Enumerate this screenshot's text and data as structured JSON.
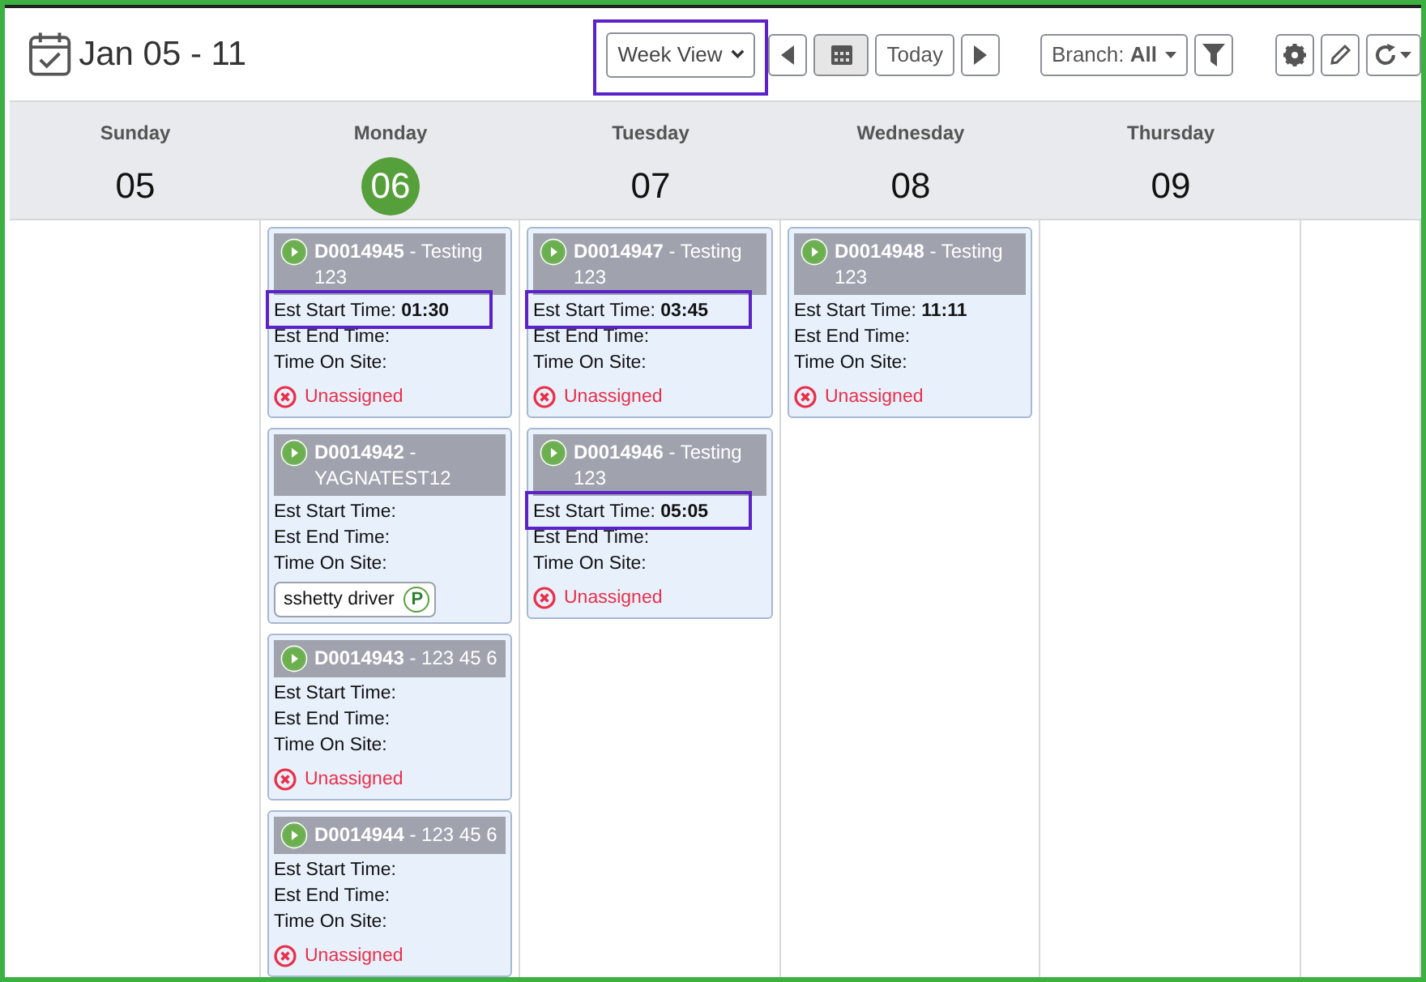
{
  "header": {
    "title": "Jan 05 - 11",
    "view_select": {
      "value": "Week View",
      "highlighted": true
    },
    "today_button": "Today",
    "branch": {
      "label": "Branch:",
      "value": "All"
    }
  },
  "days": [
    {
      "name": "Sunday",
      "number": "05",
      "selected": false
    },
    {
      "name": "Monday",
      "number": "06",
      "selected": true,
      "jobs": [
        {
          "id": "D0014945",
          "title": " - Testing 123",
          "start_label": "Est Start Time:",
          "start_time": "01:30",
          "start_highlighted": true,
          "end_label": "Est End Time:",
          "site_label": "Time On Site:",
          "assignment": {
            "kind": "unassigned",
            "text": "Unassigned"
          }
        },
        {
          "id": "D0014942",
          "title": " - YAGNATEST12",
          "start_label": "Est Start Time:",
          "start_highlighted": false,
          "end_label": "Est End Time:",
          "site_label": "Time On Site:",
          "assignment": {
            "kind": "driver",
            "text": "sshetty driver",
            "badge": "P"
          }
        },
        {
          "id": "D0014943",
          "title": " - 123 45 6",
          "start_label": "Est Start Time:",
          "start_highlighted": false,
          "end_label": "Est End Time:",
          "site_label": "Time On Site:",
          "assignment": {
            "kind": "unassigned",
            "text": "Unassigned"
          }
        },
        {
          "id": "D0014944",
          "title": " - 123 45 6",
          "start_label": "Est Start Time:",
          "start_highlighted": false,
          "end_label": "Est End Time:",
          "site_label": "Time On Site:",
          "assignment": {
            "kind": "unassigned",
            "text": "Unassigned"
          }
        }
      ]
    },
    {
      "name": "Tuesday",
      "number": "07",
      "selected": false,
      "jobs": [
        {
          "id": "D0014947",
          "title": " - Testing 123",
          "start_label": "Est Start Time:",
          "start_time": "03:45",
          "start_highlighted": true,
          "end_label": "Est End Time:",
          "site_label": "Time On Site:",
          "assignment": {
            "kind": "unassigned",
            "text": "Unassigned"
          }
        },
        {
          "id": "D0014946",
          "title": " - Testing 123",
          "start_label": "Est Start Time:",
          "start_time": "05:05",
          "start_highlighted": true,
          "end_label": "Est End Time:",
          "site_label": "Time On Site:",
          "assignment": {
            "kind": "unassigned",
            "text": "Unassigned"
          }
        }
      ]
    },
    {
      "name": "Wednesday",
      "number": "08",
      "selected": false,
      "jobs": [
        {
          "id": "D0014948",
          "title": " - Testing 123",
          "start_label": "Est Start Time:",
          "start_time": "11:11",
          "start_highlighted": false,
          "end_label": "Est End Time:",
          "site_label": "Time On Site:",
          "assignment": {
            "kind": "unassigned",
            "text": "Unassigned"
          }
        }
      ]
    },
    {
      "name": "Thursday",
      "number": "09",
      "selected": false
    }
  ]
}
